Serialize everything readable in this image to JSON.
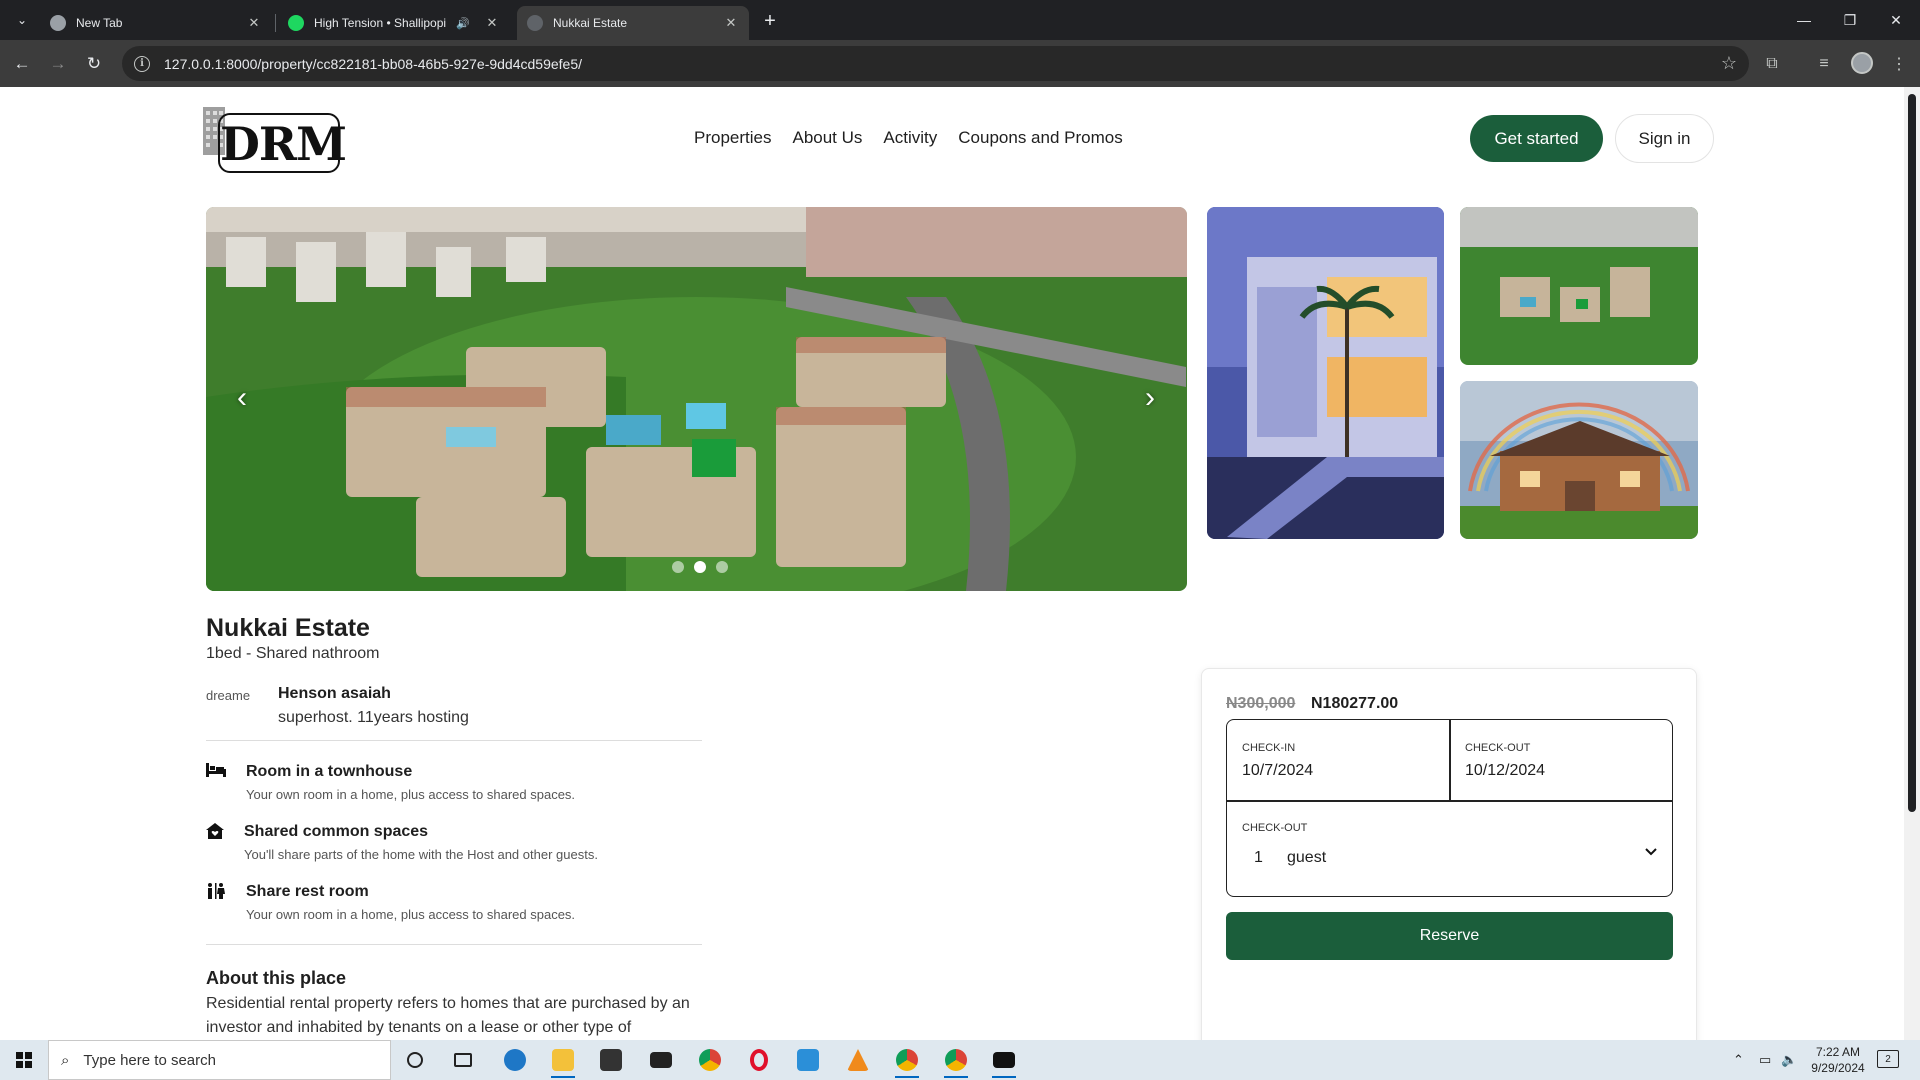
{
  "browser": {
    "tabs": [
      {
        "title": "New Tab",
        "active": false
      },
      {
        "title": "High Tension • Shallipopi",
        "active": false,
        "audio": true
      },
      {
        "title": "Nukkai Estate",
        "active": true
      }
    ],
    "url": "127.0.0.1:8000/property/cc822181-bb08-46b5-927e-9dd4cd59efe5/"
  },
  "header": {
    "logo_text": "DRM",
    "nav": [
      "Properties",
      "About Us",
      "Activity",
      "Coupons and Promos"
    ],
    "get_started": "Get started",
    "sign_in": "Sign in"
  },
  "gallery": {
    "prev_icon": "‹",
    "next_icon": "›",
    "active_slide": 2,
    "slide_count": 3
  },
  "listing": {
    "title": "Nukkai Estate",
    "subtitle": "1bed - Shared nathroom",
    "host_image_alt": "dreame",
    "host_name": "Henson asaiah",
    "host_info": "superhost. 11years hosting",
    "features": [
      {
        "icon": "bed-icon",
        "title": "Room in a townhouse",
        "desc": "Your own room in a home, plus access to shared spaces."
      },
      {
        "icon": "home-heart-icon",
        "title": "Shared common spaces",
        "desc": "You'll share parts of the home with the Host and other guests."
      },
      {
        "icon": "restroom-icon",
        "title": "Share rest room",
        "desc": "Your own room in a home, plus access to shared spaces."
      }
    ],
    "about_title": "About this place",
    "about_text": "Residential rental property refers to homes that are purchased by an investor and inhabited by tenants on a lease or other type of"
  },
  "booking": {
    "price_old": "N300,000",
    "price_new": "N180277.00",
    "checkin_label": "CHECK-IN",
    "checkin_value": "10/7/2024",
    "checkout_label": "CHECK-OUT",
    "checkout_value": "10/12/2024",
    "guests_label": "CHECK-OUT",
    "guests_value": "1",
    "guests_unit": "guest",
    "reserve": "Reserve"
  },
  "taskbar": {
    "search_placeholder": "Type here to search",
    "time": "7:22 AM",
    "date": "9/29/2024",
    "notifications": "2"
  }
}
